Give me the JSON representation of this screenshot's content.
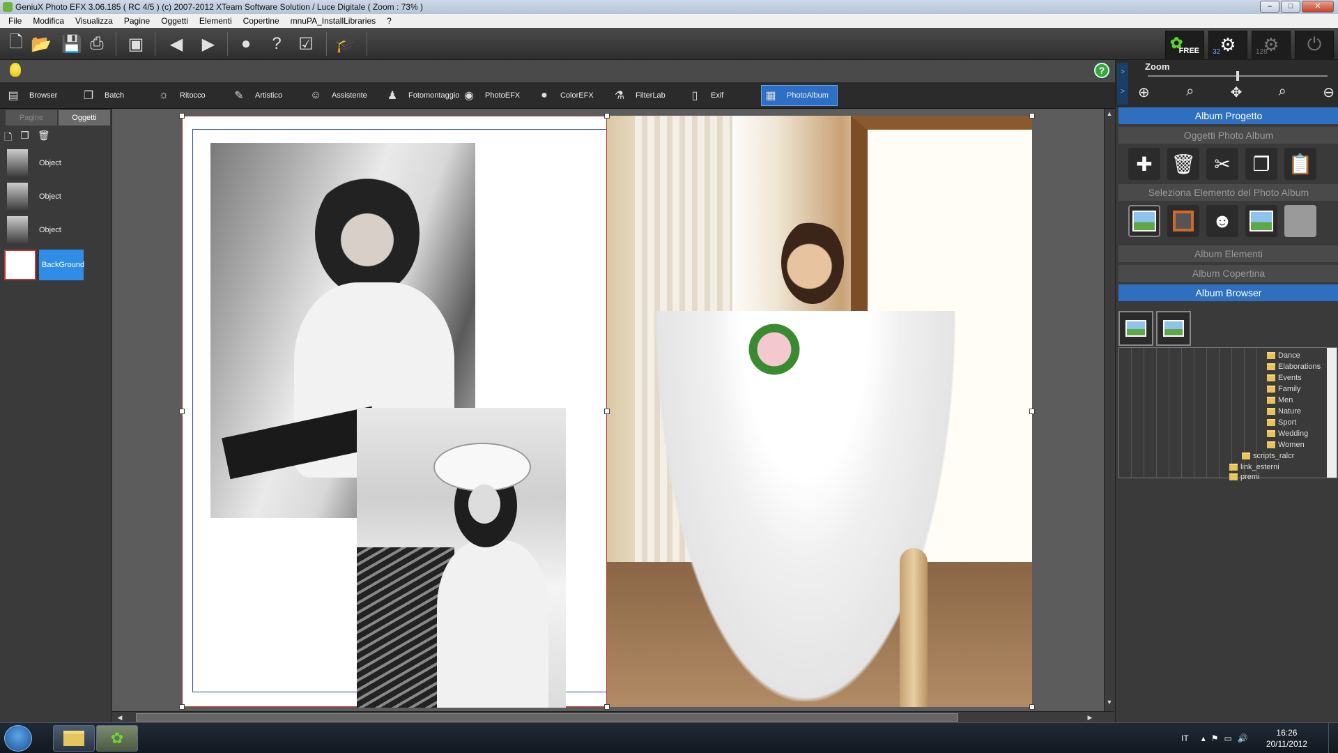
{
  "window": {
    "title": "GeniuX Photo EFX 3.06.185 ( RC 4/5 )  (c) 2007-2012 XTeam Software Solution / Luce Digitale ( Zoom : 73% )",
    "controls": [
      "–",
      "□",
      "✕"
    ]
  },
  "menu": [
    "File",
    "Modifica",
    "Visualizza",
    "Pagine",
    "Oggetti",
    "Elementi",
    "Copertine",
    "mnuPA_InstallLibraries",
    "?"
  ],
  "toolbar": {
    "icons": [
      "new-doc-icon",
      "open-folder-icon",
      "save-icon",
      "print-icon",
      "image-icon",
      "back-arrow-icon",
      "forward-arrow-icon",
      "globe-icon",
      "help-icon",
      "checklist-icon",
      "graduation-cap-icon"
    ],
    "free_label": "FREE",
    "gear_32": "32",
    "gear_128": "128"
  },
  "module_tabs": [
    {
      "label": "Browser",
      "icon": "browser-icon"
    },
    {
      "label": "Batch",
      "icon": "batch-icon"
    },
    {
      "label": "Ritocco",
      "icon": "sun-icon"
    },
    {
      "label": "Artistico",
      "icon": "brush-icon"
    },
    {
      "label": "Assistente",
      "icon": "smiley-icon"
    },
    {
      "label": "Fotomontaggio",
      "icon": "person-icon"
    },
    {
      "label": "PhotoEFX",
      "icon": "camera-icon"
    },
    {
      "label": "ColorEFX",
      "icon": "color-drop-icon"
    },
    {
      "label": "FilterLab",
      "icon": "flask-icon"
    },
    {
      "label": "Exif",
      "icon": "document-icon"
    },
    {
      "label": "PhotoAlbum",
      "icon": "album-icon",
      "active": true
    }
  ],
  "left_panel": {
    "tabs": [
      "Pagine",
      "Oggetti"
    ],
    "active_tab": "Oggetti",
    "objects": [
      "Object",
      "Object",
      "Object"
    ],
    "background_label": "BackGround"
  },
  "right_panel": {
    "zoom_label": "Zoom",
    "zoom_level": 0.5,
    "sections": {
      "album_progetto": "Album Progetto",
      "oggetti_photo_album": "Oggetti Photo Album",
      "seleziona_elemento": "Seleziona Elemento del Photo Album",
      "album_elementi": "Album Elementi",
      "album_copertina": "Album Copertina",
      "album_browser": "Album Browser"
    },
    "tree": {
      "folders": [
        "Dance",
        "Elaborations",
        "Events",
        "Family",
        "Men",
        "Nature",
        "Sport",
        "Wedding",
        "Women"
      ],
      "sub1": "scripts_ralcr",
      "sub2": "link_esterni",
      "sub3": "premi"
    }
  },
  "taskbar": {
    "lang": "IT",
    "time": "16:26",
    "date": "20/11/2012"
  }
}
